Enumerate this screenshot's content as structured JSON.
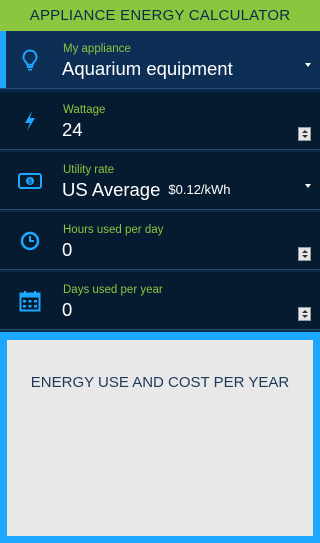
{
  "header": {
    "title": "APPLIANCE ENERGY CALCULATOR"
  },
  "fields": {
    "appliance": {
      "label": "My appliance",
      "value": "Aquarium equipment",
      "icon": "lightbulb-icon"
    },
    "wattage": {
      "label": "Wattage",
      "value": "24",
      "icon": "lightning-icon"
    },
    "utility": {
      "label": "Utility rate",
      "value": "US Average",
      "rate": "$0.12/kWh",
      "icon": "money-icon"
    },
    "hours": {
      "label": "Hours used per day",
      "value": "0",
      "icon": "clock-icon"
    },
    "days": {
      "label": "Days used per year",
      "value": "0",
      "icon": "calendar-icon"
    }
  },
  "results": {
    "title": "ENERGY USE AND COST PER YEAR"
  },
  "colors": {
    "header_bg": "#8cc63f",
    "label_green": "#8cc63f",
    "accent_blue": "#1ea7ff",
    "row_bg": "#061a30",
    "selected_row_bg": "#0e2f55"
  }
}
